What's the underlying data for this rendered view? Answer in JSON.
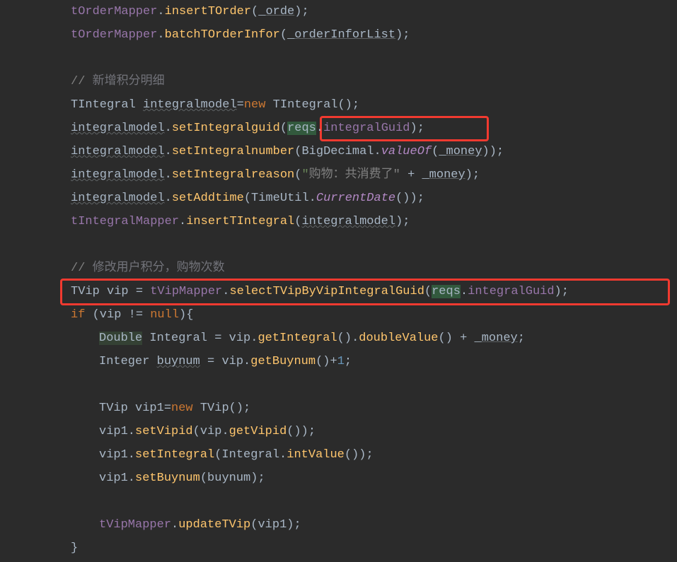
{
  "lines": {
    "l1": {
      "a": "tOrderMapper",
      "b": ".",
      "c": "insertTOrder",
      "d": "(",
      "e": "_orde",
      "f": ");"
    },
    "l2": {
      "a": "tOrderMapper",
      "b": ".",
      "c": "batchTOrderInfor",
      "d": "(",
      "e": "_orderInforList",
      "f": ");"
    },
    "l4a": "// ",
    "l4b": " 新增积分明细",
    "l5": {
      "a": "TIntegral ",
      "b": "integralmodel",
      "c": "=",
      "d": "new",
      "e": " TIntegral();"
    },
    "l6": {
      "a": "integralmodel",
      "b": ".",
      "c": "setIntegralguid",
      "d": "(",
      "e": "reqs",
      "f": ".",
      "g": "integralGuid",
      "h": ");"
    },
    "l7": {
      "a": "integralmodel",
      "b": ".",
      "c": "setIntegralnumber",
      "d": "(BigDecimal.",
      "e": "valueOf",
      "f": "(",
      "g": "_money",
      "h": "));"
    },
    "l8": {
      "a": "integralmodel",
      "b": ".",
      "c": "setIntegralreason",
      "d": "(",
      "e": "\"",
      "f": "购物：共消费了\"",
      "g": " + ",
      "h": "_money",
      "i": ");"
    },
    "l9": {
      "a": "integralmodel",
      "b": ".",
      "c": "setAddtime",
      "d": "(TimeUtil.",
      "e": "CurrentDate",
      "f": "());"
    },
    "l10": {
      "a": "tIntegralMapper",
      "b": ".",
      "c": "insertTIntegral",
      "d": "(",
      "e": "integralmodel",
      "f": ");"
    },
    "l12a": "// ",
    "l12b": " 修改用户积分，购物次数",
    "l13": {
      "a": "TVip vip = ",
      "b": "tVipMapper",
      "c": ".",
      "d": "selectTVipByVipIntegralGuid",
      "e": "(",
      "f": "reqs",
      "g": ".",
      "h": "integralGuid",
      "i": ");"
    },
    "l14": {
      "a": "if",
      "b": " (vip != ",
      "c": "null",
      "d": "){"
    },
    "l15": {
      "a": "Double",
      "b": " Integral = vip.",
      "c": "getIntegral",
      "d": "().",
      "e": "doubleValue",
      "f": "() +  ",
      "g": "_money",
      "h": ";"
    },
    "l16": {
      "a": "Integer ",
      "b": "buynum",
      "c": " = vip.",
      "d": "getBuynum",
      "e": "()+",
      "f": "1",
      "g": ";"
    },
    "l18": {
      "a": "TVip vip1=",
      "b": "new",
      "c": " TVip();"
    },
    "l19": {
      "a": "vip1.",
      "b": "setVipid",
      "c": "(vip.",
      "d": "getVipid",
      "e": "());"
    },
    "l20": {
      "a": "vip1.",
      "b": "setIntegral",
      "c": "(Integral.",
      "d": "intValue",
      "e": "());"
    },
    "l21": {
      "a": "vip1.",
      "b": "setBuynum",
      "c": "(buynum);"
    },
    "l23": {
      "a": "tVipMapper",
      "b": ".",
      "c": "updateTVip",
      "d": "(vip1);"
    },
    "l24": "}"
  }
}
